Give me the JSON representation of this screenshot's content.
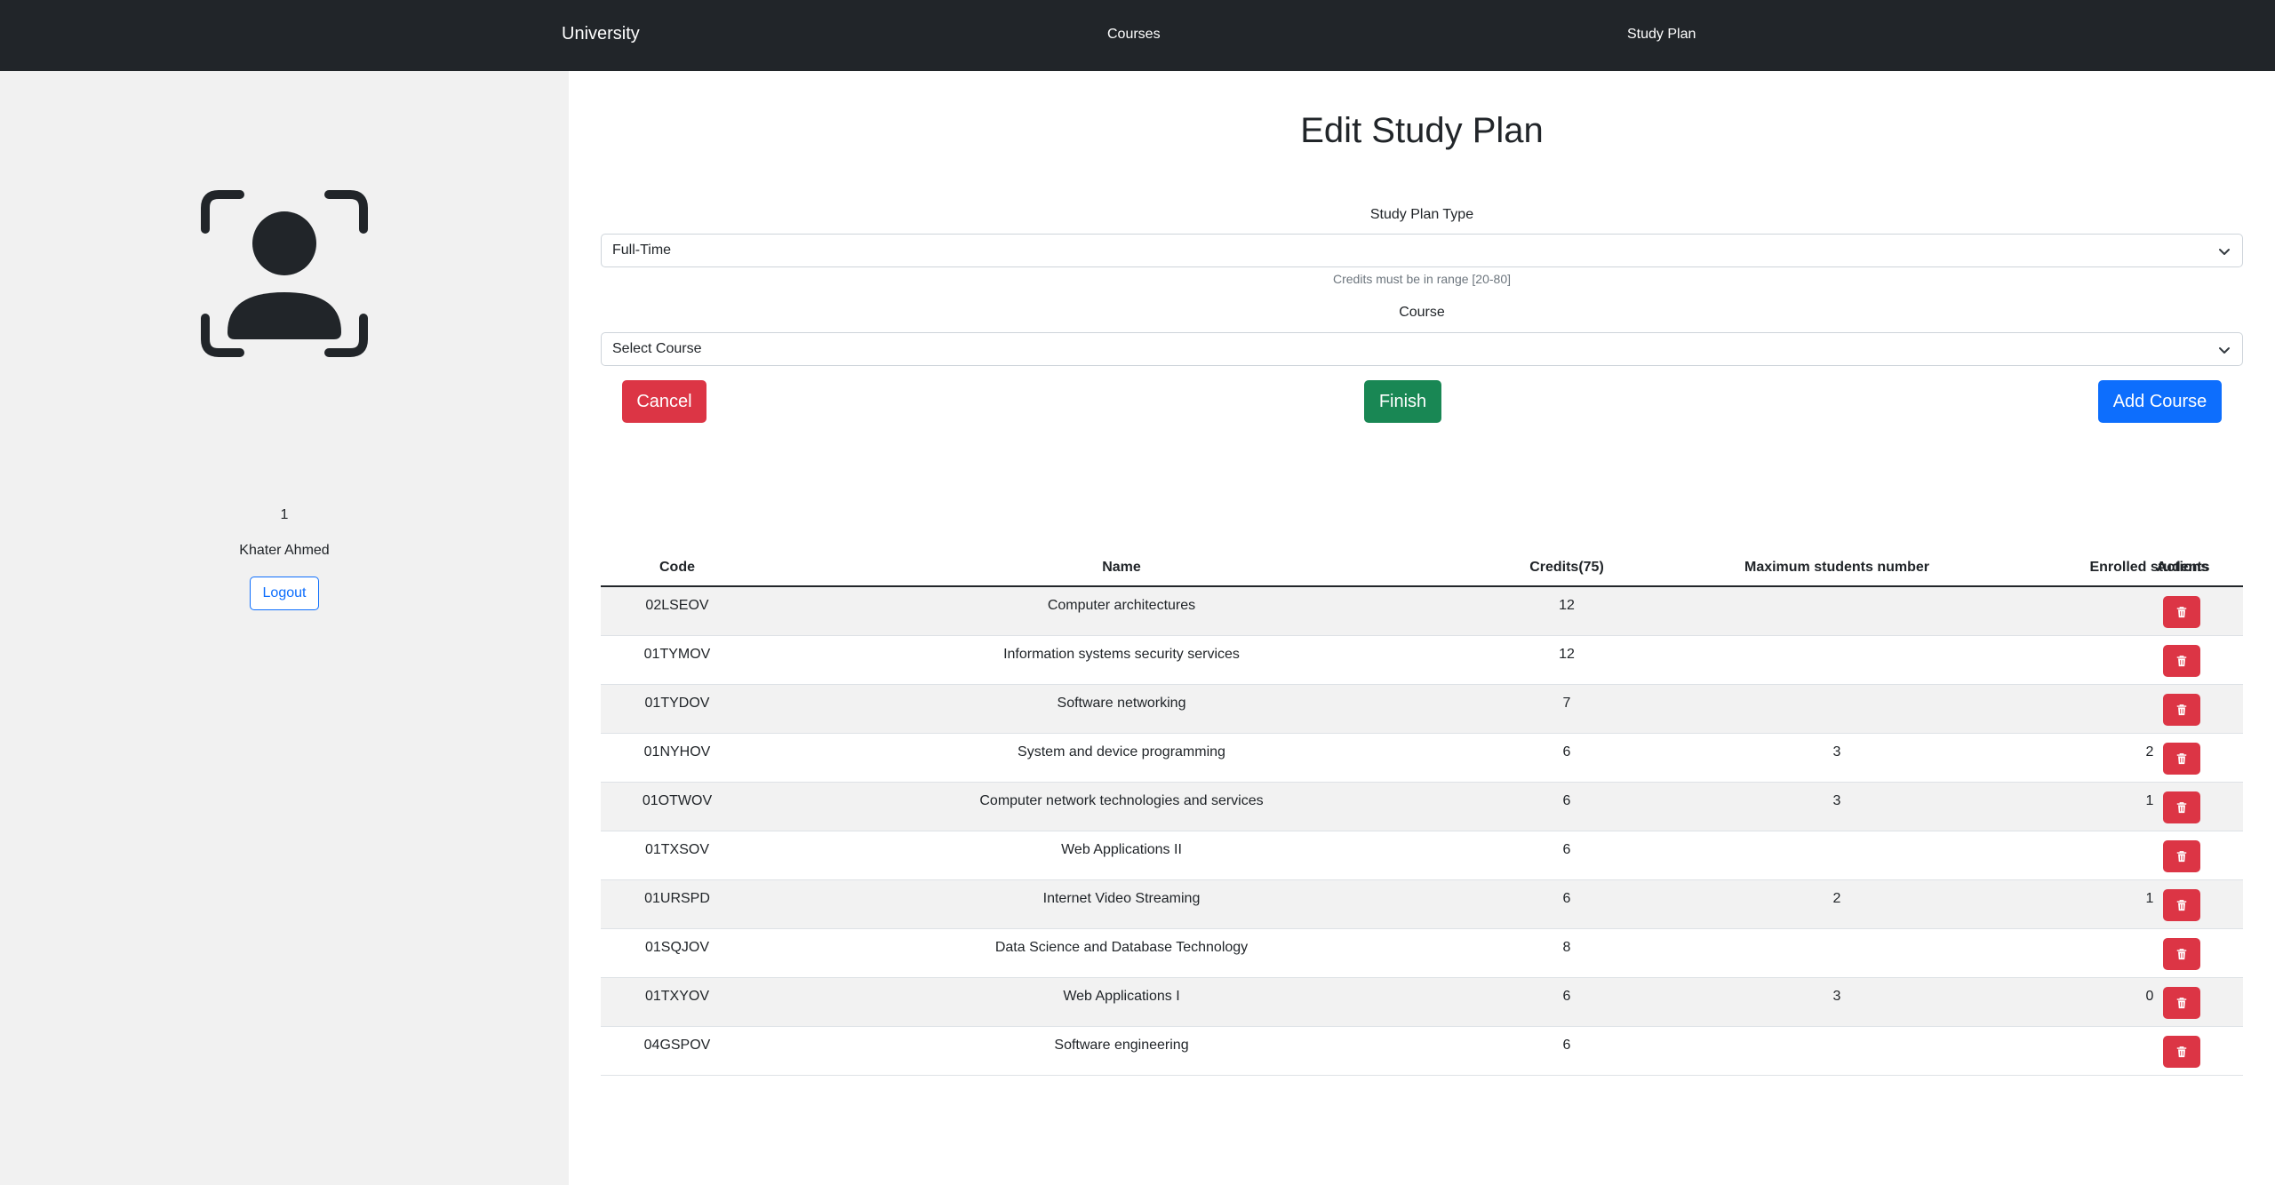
{
  "navbar": {
    "brand": "University",
    "links": [
      "Courses",
      "Study Plan"
    ]
  },
  "sidebar": {
    "avatar_icon": "person-bounding-box-icon",
    "user_id": "1",
    "user_name": "Khater Ahmed",
    "logout_label": "Logout"
  },
  "main": {
    "title": "Edit Study Plan",
    "study_plan_type_label": "Study Plan Type",
    "study_plan_type_value": "Full-Time",
    "credits_help": "Credits must be in range [20-80]",
    "course_label": "Course",
    "course_select_value": "Select Course",
    "cancel_label": "Cancel",
    "finish_label": "Finish",
    "add_label": "Add Course"
  },
  "table": {
    "headers": [
      "Code",
      "Name",
      "Credits(75)",
      "Maximum students number",
      "Enrolled students",
      "Actions"
    ],
    "rows": [
      {
        "code": "02LSEOV",
        "name": "Computer architectures",
        "credits": "12",
        "max": "",
        "enrolled": ""
      },
      {
        "code": "01TYMOV",
        "name": "Information systems security services",
        "credits": "12",
        "max": "",
        "enrolled": ""
      },
      {
        "code": "01TYDOV",
        "name": "Software networking",
        "credits": "7",
        "max": "",
        "enrolled": ""
      },
      {
        "code": "01NYHOV",
        "name": "System and device programming",
        "credits": "6",
        "max": "3",
        "enrolled": "2"
      },
      {
        "code": "01OTWOV",
        "name": "Computer network technologies and services",
        "credits": "6",
        "max": "3",
        "enrolled": "1"
      },
      {
        "code": "01TXSOV",
        "name": "Web Applications II",
        "credits": "6",
        "max": "",
        "enrolled": ""
      },
      {
        "code": "01URSPD",
        "name": "Internet Video Streaming",
        "credits": "6",
        "max": "2",
        "enrolled": "1"
      },
      {
        "code": "01SQJOV",
        "name": "Data Science and Database Technology",
        "credits": "8",
        "max": "",
        "enrolled": ""
      },
      {
        "code": "01TXYOV",
        "name": "Web Applications I",
        "credits": "6",
        "max": "3",
        "enrolled": "0"
      },
      {
        "code": "04GSPOV",
        "name": "Software engineering",
        "credits": "6",
        "max": "",
        "enrolled": ""
      }
    ]
  },
  "colors": {
    "navbar": "#212529",
    "danger": "#dc3545",
    "success": "#198754",
    "primary": "#0d6efd",
    "sidebar_bg": "#f1f1f1"
  }
}
